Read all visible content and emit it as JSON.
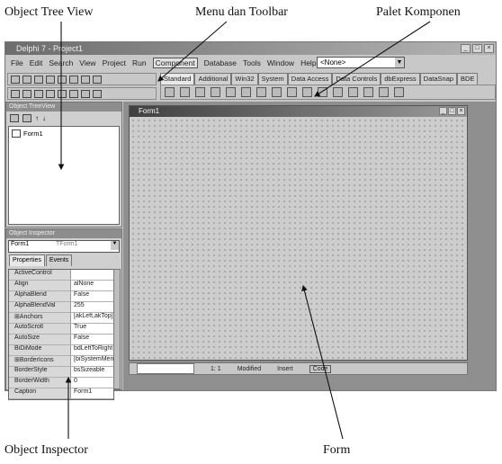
{
  "callouts": {
    "object_tree_view": "Object Tree View",
    "menu_toolbar": "Menu dan Toolbar",
    "palet_komponen": "Palet Komponen",
    "object_inspector": "Object Inspector",
    "form": "Form"
  },
  "window": {
    "title": "Delphi 7 - Project1"
  },
  "menu": [
    "File",
    "Edit",
    "Search",
    "View",
    "Project",
    "Run",
    "Component",
    "Database",
    "Tools",
    "Window",
    "Help"
  ],
  "menu_highlight_index": 6,
  "desktop_combo": "<None>",
  "palette_tabs": [
    "Standard",
    "Additional",
    "Win32",
    "System",
    "Data Access",
    "Data Controls",
    "dbExpress",
    "DataSnap",
    "BDE"
  ],
  "object_treeview": {
    "title": "Object TreeView",
    "items": [
      "Form1"
    ]
  },
  "object_inspector": {
    "title": "Object Inspector",
    "selected_object": "Form1",
    "selected_type": "TForm1",
    "tabs": [
      "Properties",
      "Events"
    ],
    "rows": [
      {
        "k": "ActiveControl",
        "v": ""
      },
      {
        "k": "Align",
        "v": "alNone"
      },
      {
        "k": "AlphaBlend",
        "v": "False"
      },
      {
        "k": "AlphaBlendVal",
        "v": "255"
      },
      {
        "k": "⊞Anchors",
        "v": "[akLeft,akTop]"
      },
      {
        "k": "AutoScroll",
        "v": "True"
      },
      {
        "k": "AutoSize",
        "v": "False"
      },
      {
        "k": "BiDiMode",
        "v": "bdLeftToRight"
      },
      {
        "k": "⊞BorderIcons",
        "v": "[biSystemMenu"
      },
      {
        "k": "BorderStyle",
        "v": "bsSizeable"
      },
      {
        "k": "BorderWidth",
        "v": "0"
      },
      {
        "k": "Caption",
        "v": "Form1"
      }
    ]
  },
  "form": {
    "title": "Form1"
  },
  "editor_status": {
    "position": "1: 1",
    "modified": "Modified",
    "mode": "Insert",
    "code_tab": "Code"
  }
}
